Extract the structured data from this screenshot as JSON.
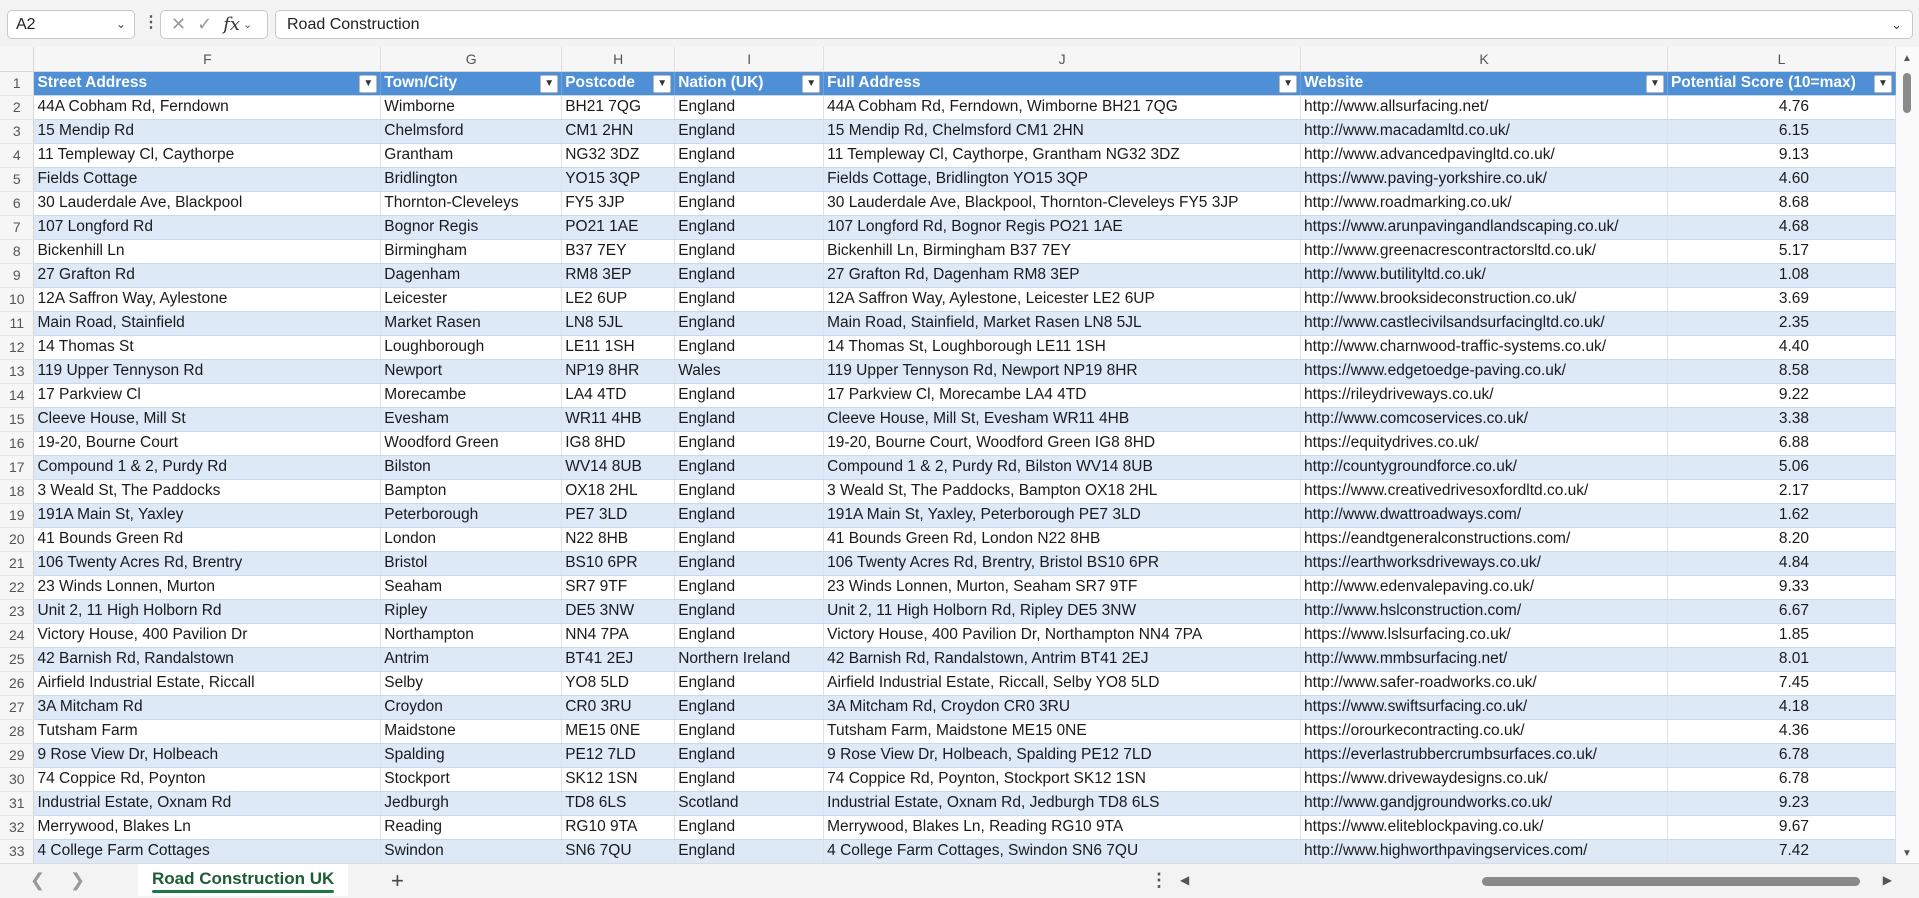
{
  "formula_bar": {
    "name_box": "A2",
    "formula": "Road Construction",
    "fx_label": "fx"
  },
  "columns": [
    {
      "letter": "F"
    },
    {
      "letter": "G"
    },
    {
      "letter": "H"
    },
    {
      "letter": "I"
    },
    {
      "letter": "J"
    },
    {
      "letter": "K"
    },
    {
      "letter": "L"
    }
  ],
  "header_row": {
    "row_number": "1",
    "cells": [
      "Street Address",
      "Town/City",
      "Postcode",
      "Nation (UK)",
      "Full Address",
      "Website",
      "Potential Score (10=max)"
    ]
  },
  "rows": [
    {
      "n": "2",
      "c": [
        "44A Cobham Rd, Ferndown",
        "Wimborne",
        "BH21 7QG",
        "England",
        "44A Cobham Rd, Ferndown, Wimborne BH21 7QG",
        "http://www.allsurfacing.net/",
        "4.76"
      ]
    },
    {
      "n": "3",
      "c": [
        "15 Mendip Rd",
        "Chelmsford",
        "CM1 2HN",
        "England",
        "15 Mendip Rd, Chelmsford CM1 2HN",
        "http://www.macadamltd.co.uk/",
        "6.15"
      ]
    },
    {
      "n": "4",
      "c": [
        "11 Templeway Cl, Caythorpe",
        "Grantham",
        "NG32 3DZ",
        "England",
        "11 Templeway Cl, Caythorpe, Grantham NG32 3DZ",
        "http://www.advancedpavingltd.co.uk/",
        "9.13"
      ]
    },
    {
      "n": "5",
      "c": [
        "Fields Cottage",
        "Bridlington",
        "YO15 3QP",
        "England",
        "Fields Cottage, Bridlington YO15 3QP",
        "https://www.paving-yorkshire.co.uk/",
        "4.60"
      ]
    },
    {
      "n": "6",
      "c": [
        "30 Lauderdale Ave, Blackpool",
        "Thornton-Cleveleys",
        "FY5 3JP",
        "England",
        "30 Lauderdale Ave, Blackpool, Thornton-Cleveleys FY5 3JP",
        "http://www.roadmarking.co.uk/",
        "8.68"
      ]
    },
    {
      "n": "7",
      "c": [
        "107 Longford Rd",
        "Bognor Regis",
        "PO21 1AE",
        "England",
        "107 Longford Rd, Bognor Regis PO21 1AE",
        "https://www.arunpavingandlandscaping.co.uk/",
        "4.68"
      ]
    },
    {
      "n": "8",
      "c": [
        "Bickenhill Ln",
        "Birmingham",
        "B37 7EY",
        "England",
        "Bickenhill Ln, Birmingham B37 7EY",
        "http://www.greenacrescontractorsltd.co.uk/",
        "5.17"
      ]
    },
    {
      "n": "9",
      "c": [
        "27 Grafton Rd",
        "Dagenham",
        "RM8 3EP",
        "England",
        "27 Grafton Rd, Dagenham RM8 3EP",
        "http://www.butilityltd.co.uk/",
        "1.08"
      ]
    },
    {
      "n": "10",
      "c": [
        "12A Saffron Way, Aylestone",
        "Leicester",
        "LE2 6UP",
        "England",
        "12A Saffron Way, Aylestone, Leicester LE2 6UP",
        "http://www.brooksideconstruction.co.uk/",
        "3.69"
      ]
    },
    {
      "n": "11",
      "c": [
        "Main Road, Stainfield",
        "Market Rasen",
        "LN8 5JL",
        "England",
        "Main Road, Stainfield, Market Rasen LN8 5JL",
        "http://www.castlecivilsandsurfacingltd.co.uk/",
        "2.35"
      ]
    },
    {
      "n": "12",
      "c": [
        "14 Thomas St",
        "Loughborough",
        "LE11 1SH",
        "England",
        "14 Thomas St, Loughborough LE11 1SH",
        "http://www.charnwood-traffic-systems.co.uk/",
        "4.40"
      ]
    },
    {
      "n": "13",
      "c": [
        "119 Upper Tennyson Rd",
        "Newport",
        "NP19 8HR",
        "Wales",
        "119 Upper Tennyson Rd, Newport NP19 8HR",
        "https://www.edgetoedge-paving.co.uk/",
        "8.58"
      ]
    },
    {
      "n": "14",
      "c": [
        "17 Parkview Cl",
        "Morecambe",
        "LA4 4TD",
        "England",
        "17 Parkview Cl, Morecambe LA4 4TD",
        "https://rileydriveways.co.uk/",
        "9.22"
      ]
    },
    {
      "n": "15",
      "c": [
        "Cleeve House, Mill St",
        "Evesham",
        "WR11 4HB",
        "England",
        "Cleeve House, Mill St, Evesham WR11 4HB",
        "http://www.comcoservices.co.uk/",
        "3.38"
      ]
    },
    {
      "n": "16",
      "c": [
        "19-20, Bourne Court",
        "Woodford Green",
        "IG8 8HD",
        "England",
        "19-20, Bourne Court, Woodford Green IG8 8HD",
        "https://equitydrives.co.uk/",
        "6.88"
      ]
    },
    {
      "n": "17",
      "c": [
        "Compound 1 & 2, Purdy Rd",
        "Bilston",
        "WV14 8UB",
        "England",
        "Compound 1 & 2, Purdy Rd, Bilston WV14 8UB",
        "http://countygroundforce.co.uk/",
        "5.06"
      ]
    },
    {
      "n": "18",
      "c": [
        "3 Weald St, The Paddocks",
        "Bampton",
        "OX18 2HL",
        "England",
        "3 Weald St, The Paddocks, Bampton OX18 2HL",
        "https://www.creativedrivesoxfordltd.co.uk/",
        "2.17"
      ]
    },
    {
      "n": "19",
      "c": [
        "191A Main St, Yaxley",
        "Peterborough",
        "PE7 3LD",
        "England",
        "191A Main St, Yaxley, Peterborough PE7 3LD",
        "http://www.dwattroadways.com/",
        "1.62"
      ]
    },
    {
      "n": "20",
      "c": [
        "41 Bounds Green Rd",
        "London",
        "N22 8HB",
        "England",
        "41 Bounds Green Rd, London N22 8HB",
        "https://eandtgeneralconstructions.com/",
        "8.20"
      ]
    },
    {
      "n": "21",
      "c": [
        "106 Twenty Acres Rd, Brentry",
        "Bristol",
        "BS10 6PR",
        "England",
        "106 Twenty Acres Rd, Brentry, Bristol BS10 6PR",
        "https://earthworksdriveways.co.uk/",
        "4.84"
      ]
    },
    {
      "n": "22",
      "c": [
        "23 Winds Lonnen, Murton",
        "Seaham",
        "SR7 9TF",
        "England",
        "23 Winds Lonnen, Murton, Seaham SR7 9TF",
        "http://www.edenvalepaving.co.uk/",
        "9.33"
      ]
    },
    {
      "n": "23",
      "c": [
        "Unit 2, 11 High Holborn Rd",
        "Ripley",
        "DE5 3NW",
        "England",
        "Unit 2, 11 High Holborn Rd, Ripley DE5 3NW",
        "http://www.hslconstruction.com/",
        "6.67"
      ]
    },
    {
      "n": "24",
      "c": [
        "Victory House, 400 Pavilion Dr",
        "Northampton",
        "NN4 7PA",
        "England",
        "Victory House, 400 Pavilion Dr, Northampton NN4 7PA",
        "https://www.lslsurfacing.co.uk/",
        "1.85"
      ]
    },
    {
      "n": "25",
      "c": [
        "42 Barnish Rd, Randalstown",
        "Antrim",
        "BT41 2EJ",
        "Northern Ireland",
        "42 Barnish Rd, Randalstown, Antrim BT41 2EJ",
        "http://www.mmbsurfacing.net/",
        "8.01"
      ]
    },
    {
      "n": "26",
      "c": [
        "Airfield Industrial Estate, Riccall",
        "Selby",
        "YO8 5LD",
        "England",
        "Airfield Industrial Estate, Riccall, Selby YO8 5LD",
        "http://www.safer-roadworks.co.uk/",
        "7.45"
      ]
    },
    {
      "n": "27",
      "c": [
        "3A Mitcham Rd",
        "Croydon",
        "CR0 3RU",
        "England",
        "3A Mitcham Rd, Croydon CR0 3RU",
        "https://www.swiftsurfacing.co.uk/",
        "4.18"
      ]
    },
    {
      "n": "28",
      "c": [
        "Tutsham Farm",
        "Maidstone",
        "ME15 0NE",
        "England",
        "Tutsham Farm, Maidstone ME15 0NE",
        "https://orourkecontracting.co.uk/",
        "4.36"
      ]
    },
    {
      "n": "29",
      "c": [
        "9 Rose View Dr, Holbeach",
        "Spalding",
        "PE12 7LD",
        "England",
        "9 Rose View Dr, Holbeach, Spalding PE12 7LD",
        "https://everlastrubbercrumbsurfaces.co.uk/",
        "6.78"
      ]
    },
    {
      "n": "30",
      "c": [
        "74 Coppice Rd, Poynton",
        "Stockport",
        "SK12 1SN",
        "England",
        "74 Coppice Rd, Poynton, Stockport SK12 1SN",
        "https://www.drivewaydesigns.co.uk/",
        "6.78"
      ]
    },
    {
      "n": "31",
      "c": [
        "Industrial Estate, Oxnam Rd",
        "Jedburgh",
        "TD8 6LS",
        "Scotland",
        "Industrial Estate, Oxnam Rd, Jedburgh TD8 6LS",
        "http://www.gandjgroundworks.co.uk/",
        "9.23"
      ]
    },
    {
      "n": "32",
      "c": [
        "Merrywood, Blakes Ln",
        "Reading",
        "RG10 9TA",
        "England",
        "Merrywood, Blakes Ln, Reading RG10 9TA",
        "https://www.eliteblockpaving.co.uk/",
        "9.67"
      ]
    },
    {
      "n": "33",
      "c": [
        "4 College Farm Cottages",
        "Swindon",
        "SN6 7QU",
        "England",
        "4 College Farm Cottages, Swindon SN6 7QU",
        "http://www.highworthpavingservices.com/",
        "7.42"
      ]
    }
  ],
  "sheet_tabs": {
    "active": "Road Construction UK",
    "add_label": "+"
  },
  "icons": {
    "cancel": "close-icon",
    "enter": "check-icon",
    "function": "fx-icon"
  },
  "colors": {
    "header_fill": "#4e8fd6",
    "band_fill": "#dde9f7",
    "active_tab": "#1b7a43"
  }
}
